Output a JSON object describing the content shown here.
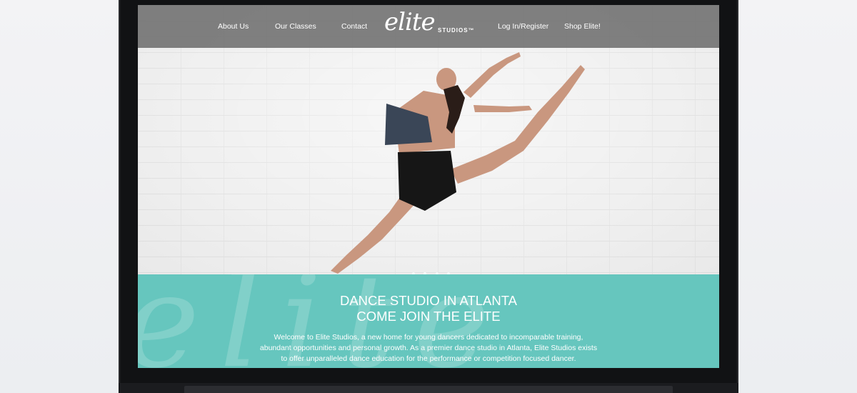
{
  "nav": {
    "items": [
      {
        "label": "About Us"
      },
      {
        "label": "Our Classes"
      },
      {
        "label": "Contact"
      },
      {
        "label": "Log In/Register"
      },
      {
        "label": "Shop Elite!"
      }
    ],
    "logo": {
      "script": "elite",
      "sub": "STUDIOS™"
    }
  },
  "hero": {
    "image": "dancer-leaping-icon",
    "slides_total": 4,
    "slide_active": 2
  },
  "band": {
    "heading_line1": "DANCE STUDIO IN ATLANTA",
    "heading_line2": "COME JOIN THE ELITE",
    "body": "Welcome to Elite Studios, a new home for young dancers dedicated to incomparable training, abundant opportunities and personal growth. As a premier dance studio in Atlanta, Elite Studios exists to offer unparalleled dance education for the performance or competition focused dancer.",
    "watermark": "elite"
  },
  "colors": {
    "teal": "#66c6be",
    "nav_bg": "#6e6e6e",
    "bezel": "#111214"
  }
}
